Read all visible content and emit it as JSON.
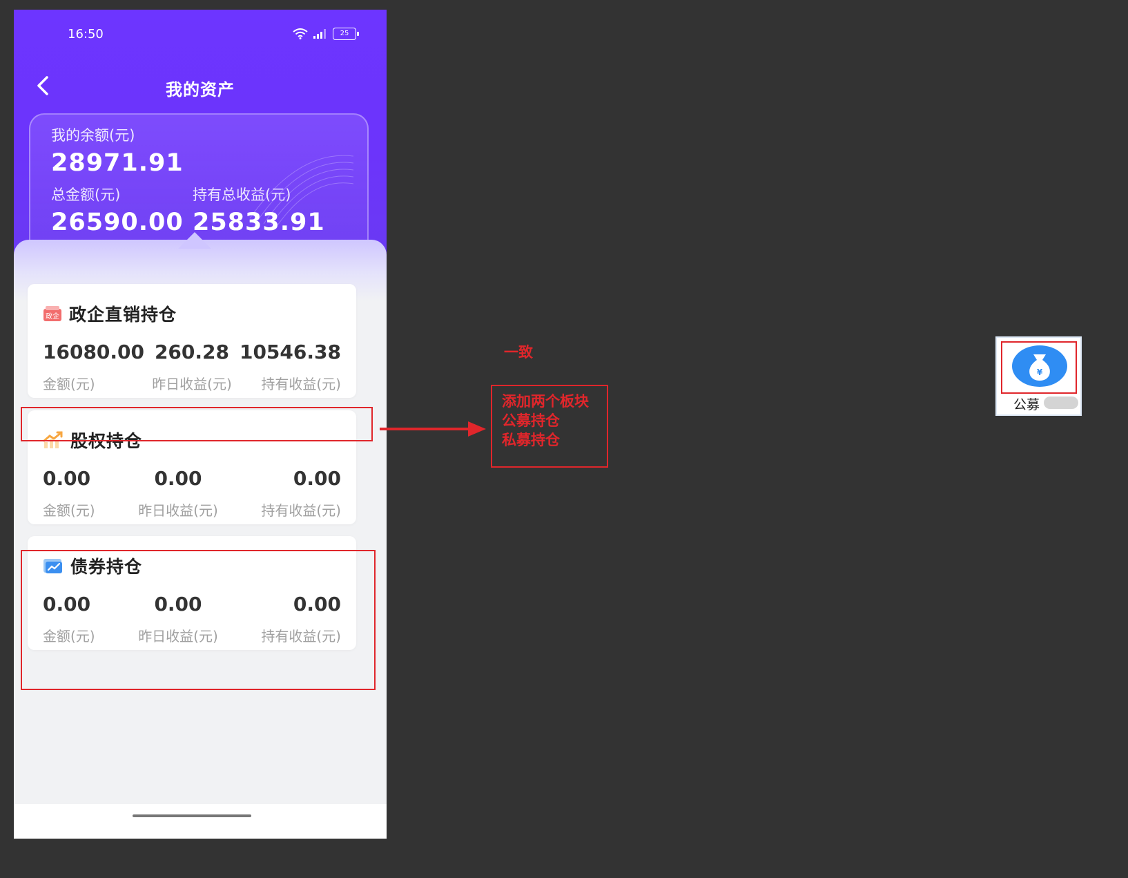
{
  "status_bar": {
    "time": "16:50",
    "battery": "25"
  },
  "nav": {
    "title": "我的资产"
  },
  "balance": {
    "my_balance_label": "我的余额(元)",
    "my_balance_value": "28971.91",
    "total_amount_label": "总金额(元)",
    "total_amount_value": "26590.00",
    "total_income_label": "持有总收益(元)",
    "total_income_value": "25833.91"
  },
  "holdings": [
    {
      "title": "政企直销持仓",
      "icon": "gov-enterprise-icon",
      "amount": "16080.00",
      "amount_label": "金额(元)",
      "yesterday": "260.28",
      "yesterday_label": "昨日收益(元)",
      "holding": "10546.38",
      "holding_label": "持有收益(元)"
    },
    {
      "title": "股权持仓",
      "icon": "trend-chart-icon",
      "amount": "0.00",
      "amount_label": "金额(元)",
      "yesterday": "0.00",
      "yesterday_label": "昨日收益(元)",
      "holding": "0.00",
      "holding_label": "持有收益(元)"
    },
    {
      "title": "债券持仓",
      "icon": "bond-chart-icon",
      "amount": "0.00",
      "amount_label": "金额(元)",
      "yesterday": "0.00",
      "yesterday_label": "昨日收益(元)",
      "holding": "0.00",
      "holding_label": "持有收益(元)"
    }
  ],
  "annotations": {
    "consistent": "一致",
    "add_lines": [
      "添加两个板块",
      "公募持仓",
      "私募持仓"
    ]
  },
  "side_widget": {
    "label": "公募"
  },
  "colors": {
    "accent": "#6d35ff",
    "annotation_red": "#e0262b"
  }
}
